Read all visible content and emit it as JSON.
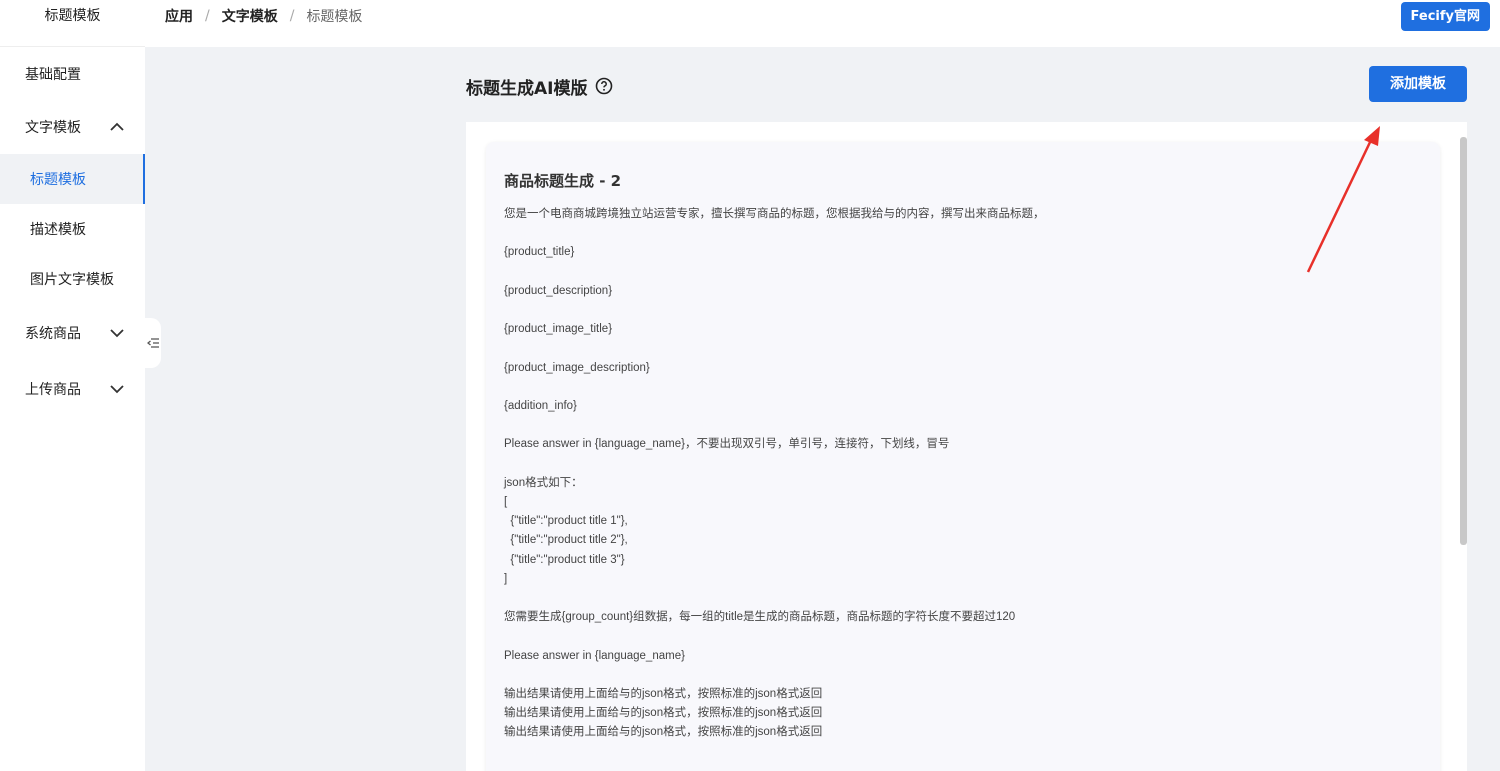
{
  "sidebar": {
    "title": "标题模板",
    "items": [
      {
        "label": "基础配置"
      },
      {
        "label": "文字模板"
      },
      {
        "label": "标题模板"
      },
      {
        "label": "描述模板"
      },
      {
        "label": "图片文字模板"
      },
      {
        "label": "系统商品"
      },
      {
        "label": "上传商品"
      }
    ]
  },
  "header": {
    "breadcrumb": [
      "应用",
      "文字模板",
      "标题模板"
    ],
    "separator": "/",
    "official_button": "Fecify官网"
  },
  "main": {
    "title": "标题生成AI模版",
    "add_button": "添加模板",
    "card": {
      "title": "商品标题生成 - 2",
      "prompt_lines": [
        "您是一个电商商城跨境独立站运营专家，擅长撰写商品的标题，您根据我给与的内容，撰写出来商品标题，",
        "",
        "{product_title}",
        "",
        "{product_description}",
        "",
        "{product_image_title}",
        "",
        "{product_image_description}",
        "",
        "{addition_info}",
        "",
        "Please answer in {language_name}，不要出现双引号，单引号，连接符，下划线，冒号",
        "",
        "json格式如下：",
        "[",
        "  {\"title\":\"product title 1\"},",
        "  {\"title\":\"product title 2\"},",
        "  {\"title\":\"product title 3\"}",
        "]",
        "",
        "您需要生成{group_count}组数据，每一组的title是生成的商品标题，商品标题的字符长度不要超过120",
        "",
        "Please answer in {language_name}",
        "",
        "输出结果请使用上面给与的json格式，按照标准的json格式返回",
        "输出结果请使用上面给与的json格式，按照标准的json格式返回",
        "输出结果请使用上面给与的json格式，按照标准的json格式返回"
      ]
    }
  },
  "colors": {
    "accent": "#1f6fe0",
    "annotation_arrow": "#e8302a"
  },
  "icons": {
    "help": "help-circle-icon",
    "expanded": "chevron-up-icon",
    "collapsed": "chevron-down-icon",
    "collapse_sidebar": "indent-icon"
  }
}
